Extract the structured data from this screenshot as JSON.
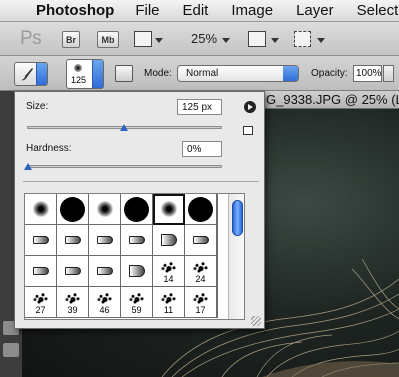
{
  "menubar": {
    "app_name": "Photoshop",
    "items": [
      "File",
      "Edit",
      "Image",
      "Layer",
      "Select"
    ]
  },
  "appbar": {
    "logo": "Ps",
    "bridge_label": "Br",
    "minibridge_label": "Mb",
    "zoom": "25%"
  },
  "options": {
    "brush_size_preview": "125",
    "mode_label": "Mode:",
    "mode_value": "Normal",
    "opacity_label": "Opacity:",
    "opacity_value": "100%"
  },
  "document": {
    "tab_title": "G_9338.JPG @ 25% (L"
  },
  "brush_picker": {
    "size_label": "Size:",
    "size_value": "125 px",
    "size_fraction": 0.49,
    "hardness_label": "Hardness:",
    "hardness_value": "0%",
    "hardness_fraction": 0.0,
    "presets": [
      {
        "kind": "soft",
        "label": ""
      },
      {
        "kind": "hard",
        "label": ""
      },
      {
        "kind": "soft",
        "label": ""
      },
      {
        "kind": "hard",
        "label": ""
      },
      {
        "kind": "soft",
        "label": "",
        "selected": true
      },
      {
        "kind": "hard",
        "label": ""
      },
      {
        "kind": "tip",
        "label": ""
      },
      {
        "kind": "tip",
        "label": ""
      },
      {
        "kind": "tip",
        "label": ""
      },
      {
        "kind": "tip",
        "label": ""
      },
      {
        "kind": "fan",
        "label": ""
      },
      {
        "kind": "tip",
        "label": ""
      },
      {
        "kind": "tip",
        "label": ""
      },
      {
        "kind": "tip",
        "label": ""
      },
      {
        "kind": "tip",
        "label": ""
      },
      {
        "kind": "fan",
        "label": ""
      },
      {
        "kind": "splat",
        "label": "14"
      },
      {
        "kind": "splat",
        "label": "24"
      },
      {
        "kind": "splat",
        "label": "27"
      },
      {
        "kind": "splat",
        "label": "39"
      },
      {
        "kind": "splat",
        "label": "46"
      },
      {
        "kind": "splat",
        "label": "59"
      },
      {
        "kind": "splat",
        "label": "11"
      },
      {
        "kind": "splat",
        "label": "17"
      }
    ]
  }
}
